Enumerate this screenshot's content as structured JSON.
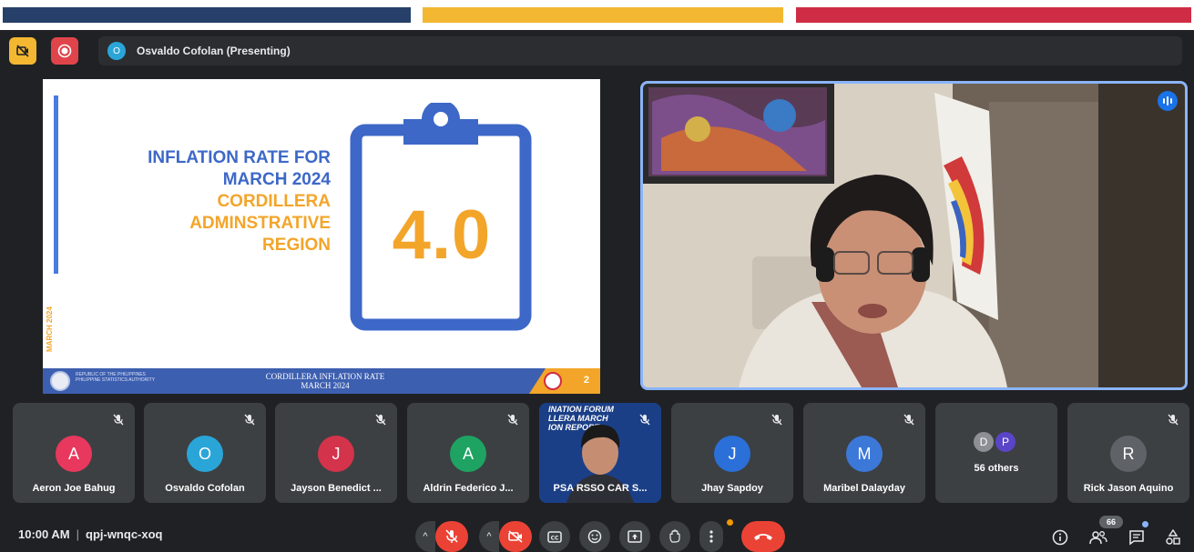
{
  "window": {
    "stripe_colors": [
      "#27406a",
      "#f3b731",
      "#cf2d45"
    ],
    "accent": "#8ab4f8",
    "end_call_color": "#ea4335"
  },
  "topbar": {
    "camera_icon": "camera-off-icon",
    "record_icon": "recording-icon",
    "presenter_initial": "O",
    "presenter_text": "Osvaldo Cofolan (Presenting)"
  },
  "slide": {
    "vertical_label": "MARCH 2024",
    "title_lines": [
      "INFLATION RATE FOR",
      "MARCH 2024"
    ],
    "region_lines": [
      "CORDILLERA",
      "ADMINSTRATIVE",
      "REGION"
    ],
    "rate": "4.0",
    "footer_left": [
      "REPUBLIC OF THE PHILIPPINES",
      "PHILIPPINE STATISTICS AUTHORITY"
    ],
    "footer_center": [
      "CORDILLERA INFLATION RATE",
      "MARCH 2024"
    ],
    "page_number": "2"
  },
  "video": {
    "speaking_icon": "audio-level-icon"
  },
  "participants": [
    {
      "name": "Aeron Joe Bahug",
      "initial": "A",
      "color": "#e8385d"
    },
    {
      "name": "Osvaldo Cofolan",
      "initial": "O",
      "color": "#2aa5d8"
    },
    {
      "name": "Jayson Benedict ...",
      "initial": "J",
      "color": "#d3334b"
    },
    {
      "name": "Aldrin Federico J...",
      "initial": "A",
      "color": "#1ea362"
    },
    {
      "name": "PSA RSSO CAR S...",
      "camera_text": [
        "INATION FORUM",
        "LLERA MARCH",
        "ION REPORT"
      ]
    },
    {
      "name": "Jhay Sapdoy",
      "initial": "J",
      "color": "#2b6fd8"
    },
    {
      "name": "Maribel Dalayday",
      "initial": "M",
      "color": "#3c78d8"
    },
    {
      "others_label": "56 others",
      "mini": [
        {
          "initial": "D",
          "color": "#8c8f94"
        },
        {
          "initial": "P",
          "color": "#5a44c8"
        }
      ]
    },
    {
      "name": "Rick Jason Aquino",
      "initial": "R",
      "color": "#5f6368"
    }
  ],
  "bottombar": {
    "time": "10:00 AM",
    "meeting_code": "qpj-wnqc-xoq",
    "people_count": "66"
  }
}
